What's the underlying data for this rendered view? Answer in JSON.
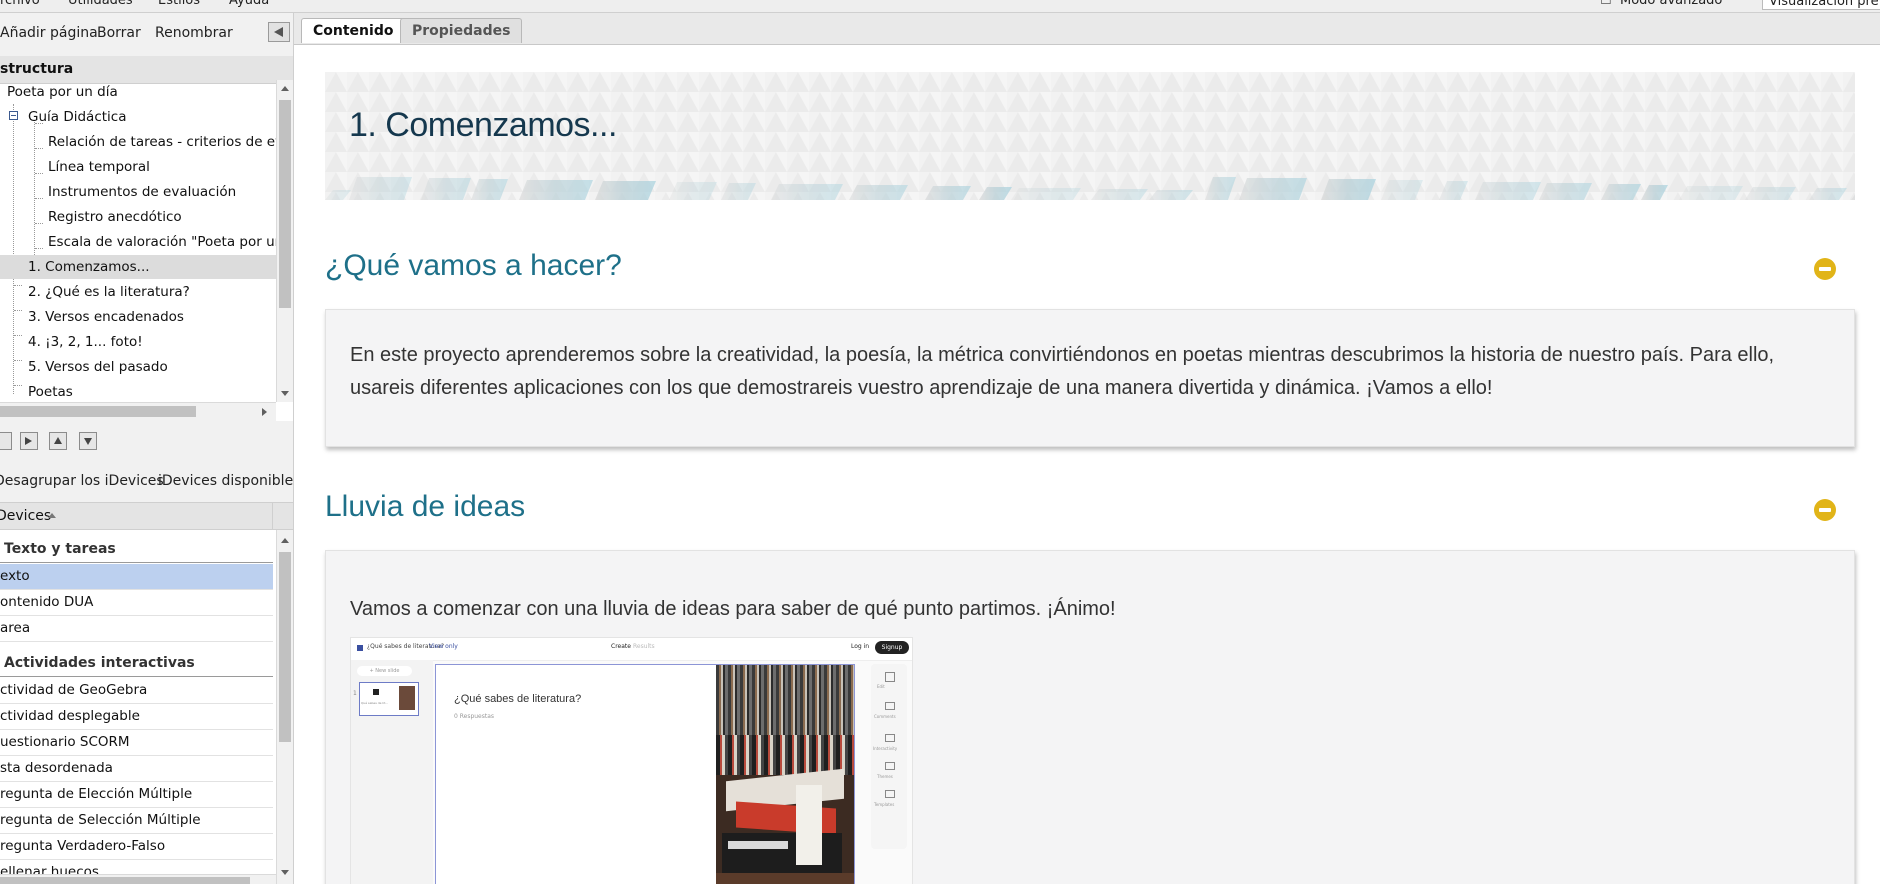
{
  "menubar": {
    "items": [
      "rchivo",
      "Utilidades",
      "Estilos",
      "Ayuda"
    ],
    "advanced_mode": "Modo avanzado",
    "preview": "Visualización previ"
  },
  "nav_toolbar": {
    "add_page": "Añadir página",
    "delete": "Borrar",
    "rename": "Renombrar"
  },
  "structure": {
    "header": "structura",
    "nodes": [
      {
        "label": "Poeta por un día"
      },
      {
        "label": "Guía Didáctica"
      },
      {
        "label": "Relación de tareas - criterios de evalu"
      },
      {
        "label": "Línea temporal"
      },
      {
        "label": "Instrumentos de evaluación"
      },
      {
        "label": "Registro anecdótico"
      },
      {
        "label": "Escala de valoración \"Poeta por un día"
      },
      {
        "label": "1. Comenzamos..."
      },
      {
        "label": "2. ¿Qué es la literatura?"
      },
      {
        "label": "3. Versos encadenados"
      },
      {
        "label": "4. ¡3, 2, 1... foto!"
      },
      {
        "label": "5. Versos del pasado"
      },
      {
        "label": "Poetas"
      }
    ]
  },
  "idevices_toolbar": {
    "ungroup": "Desagrupar los iDevices",
    "available": "iDevices disponibles"
  },
  "idevices": {
    "header": "Devices",
    "categories": [
      {
        "name": "Texto y tareas",
        "items": [
          "exto",
          "ontenido DUA",
          "area"
        ]
      },
      {
        "name": "Actividades interactivas",
        "items": [
          "ctividad de GeoGebra",
          "ctividad desplegable",
          "uestionario SCORM",
          "sta desordenada",
          "regunta de Elección Múltiple",
          "regunta de Selección Múltiple",
          "regunta Verdadero-Falso",
          "ellenar huecos"
        ]
      }
    ]
  },
  "tabs": {
    "content": "Contenido",
    "properties": "Propiedades"
  },
  "page": {
    "title": "1. Comenzamos...",
    "sections": [
      {
        "title": "¿Qué vamos a hacer?",
        "lines": [
          "En este proyecto aprenderemos sobre la creatividad, la poesía, la métrica convirtiéndonos en poetas mientras descubrimos la historia de nuestro país. Para ello,",
          "usareis diferentes aplicaciones con los que demostrareis vuestro aprendizaje de una manera divertida y dinámica. ¡Vamos a ello!"
        ]
      },
      {
        "title": "Lluvia de ideas",
        "lines": [
          "Vamos a comenzar con una lluvia de ideas para saber de qué punto partimos. ¡Ánimo!"
        ]
      }
    ]
  },
  "embed": {
    "breadcrumb": "¿Qué sabes de literatura?",
    "view_only": "View only",
    "create": "Create",
    "results": "Results",
    "login": "Log in",
    "signup": "Signup",
    "new_slide": "+ New slide",
    "slide_title": "¿Qué sabes de literatura?",
    "responses": "0 Respuestas",
    "side_tools": [
      "Edit",
      "Comments",
      "Interactivity",
      "Themes",
      "Templates"
    ],
    "thumb_caption": "Qué sabes de lit..."
  },
  "colors": {
    "accent": "#1e7089",
    "title": "#15384e",
    "toggle": "#e1b418",
    "selected_item": "#bcd0ef"
  }
}
